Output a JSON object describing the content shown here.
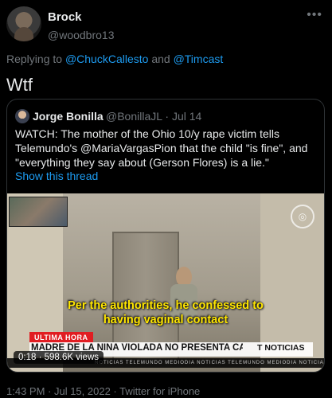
{
  "author": {
    "display_name": "Brock",
    "handle": "@woodbro13"
  },
  "reply_context": {
    "prefix": "Replying to",
    "mention_1": "@ChuckCallesto",
    "conjunction": "and",
    "mention_2": "@Timcast"
  },
  "tweet": {
    "text": "Wtf",
    "timestamp": "1:43 PM · Jul 15, 2022 · Twitter for iPhone"
  },
  "quoted_tweet": {
    "author_name": "Jorge Bonilla",
    "handle_date": "@BonillaJL · Jul 14",
    "text": "WATCH: The mother of the Ohio 10/y rape victim tells Telemundo's @MariaVargasPion that the child \"is fine\", and \"everything they say about (Gerson Flores) is a lie.\"",
    "show_thread_label": "Show this thread",
    "video": {
      "subtitle_line_1": "Per the authorities, he confessed to",
      "subtitle_line_2": "having vaginal contact",
      "breaking_label": "ULTIMA HORA",
      "headline": "MADRE DE LA NIÑA VIOLADA NO PRESENTA CARGOS",
      "network": "NOTICIAS",
      "network_icon": "telemundo-t-icon",
      "ticker": "NOTICIAS TELEMUNDO MEDIODIA     NOTICIAS TELEMUNDO MEDIODIA     NOTICIAS TELEMUNDO",
      "views": "0:18 · 598.6K views"
    }
  },
  "colors": {
    "background": "#000000",
    "text": "#e7e9ea",
    "muted": "#71767b",
    "link": "#1d9bf0",
    "subtitle": "#ffe600",
    "breaking": "#e11d22"
  }
}
